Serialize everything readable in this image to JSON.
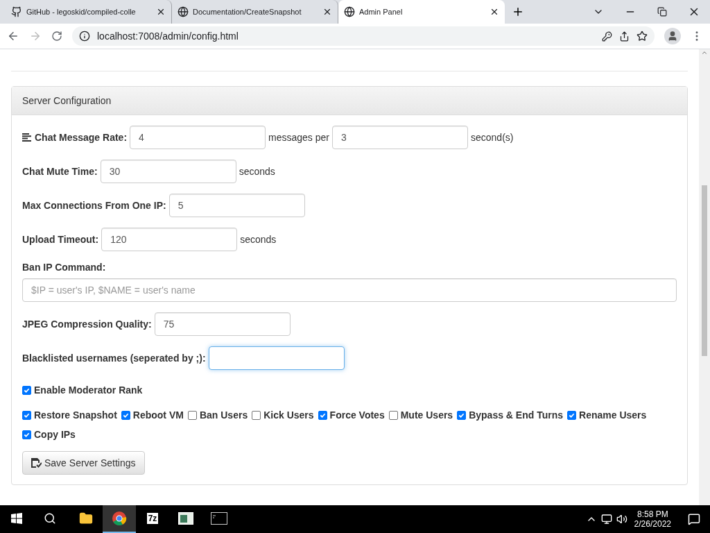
{
  "browser": {
    "tabs": [
      {
        "title": "GitHub - legoskid/compiled-colle",
        "kind": "github",
        "selected": false
      },
      {
        "title": "Documentation/CreateSnapshot",
        "kind": "globe",
        "selected": false
      },
      {
        "title": "Admin Panel",
        "kind": "globe",
        "selected": true
      }
    ],
    "url": "localhost:7008/admin/config.html"
  },
  "panel": {
    "title": "Server Configuration",
    "rows": [
      {
        "kind": "rate",
        "label": "Chat Message Rate:",
        "value": "4",
        "middle": "messages per",
        "value2": "3",
        "suffix": "second(s)"
      },
      {
        "kind": "inline",
        "label": "Chat Mute Time:",
        "value": "30",
        "suffix": "seconds"
      },
      {
        "kind": "inline",
        "label": "Max Connections From One IP:",
        "value": "5"
      },
      {
        "kind": "inline",
        "label": "Upload Timeout:",
        "value": "120",
        "suffix": "seconds"
      },
      {
        "kind": "block",
        "label": "Ban IP Command:",
        "placeholder": "$IP = user's IP, $NAME = user's name"
      },
      {
        "kind": "inline",
        "label": "JPEG Compression Quality:",
        "value": "75"
      },
      {
        "kind": "inline",
        "label": "Blacklisted usernames (seperated by ;):",
        "value": "",
        "focused": true
      }
    ],
    "moderator": {
      "label": "Enable Moderator Rank",
      "checked": true
    },
    "permissions": [
      {
        "label": "Restore Snapshot",
        "checked": true
      },
      {
        "label": "Reboot VM",
        "checked": true
      },
      {
        "label": "Ban Users",
        "checked": false
      },
      {
        "label": "Kick Users",
        "checked": false
      },
      {
        "label": "Force Votes",
        "checked": true
      },
      {
        "label": "Mute Users",
        "checked": false
      },
      {
        "label": "Bypass & End Turns",
        "checked": true
      },
      {
        "label": "Rename Users",
        "checked": true
      },
      {
        "label": "Copy IPs",
        "checked": true
      }
    ],
    "save_button": "Save Server Settings"
  },
  "taskbar": {
    "apps": [
      {
        "kind": "folder",
        "selected": false
      },
      {
        "kind": "chrome",
        "selected": true
      },
      {
        "kind": "sevenzip",
        "text": "7z",
        "selected": false
      },
      {
        "kind": "window",
        "selected": false
      },
      {
        "kind": "terminal",
        "selected": false
      }
    ],
    "time": "8:58 PM",
    "date": "2/26/2022"
  }
}
